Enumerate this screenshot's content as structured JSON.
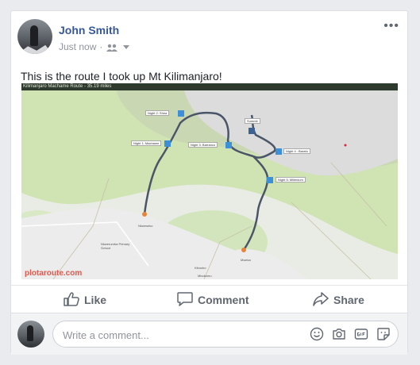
{
  "post": {
    "author": "John Smith",
    "time": "Just now",
    "more_label": "•••",
    "text": "This is the route I took up Mt Kilimanjaro!"
  },
  "map": {
    "title": "Kilimanjaro Machame Route - 35.19 miles",
    "logo": "plotaroute.com",
    "labels": {
      "night2": "Night 2: Shira",
      "night1": "Night 1: Machame",
      "night3": "Night 3: Barranco",
      "summit": "Summit",
      "night4": "Night 4 : Barafu",
      "night5": "Night 5: Millenium",
      "nkweseko": "Nkweseko",
      "mweka": "Mweka",
      "school": "Nkwerumba Primary School",
      "kibosho": "Kibosho",
      "mbokomu": "Mbokomu"
    }
  },
  "actions": {
    "like": "Like",
    "comment": "Comment",
    "share": "Share"
  },
  "comment_box": {
    "placeholder": "Write a comment..."
  },
  "icons": [
    "friends-icon",
    "dropdown-icon",
    "like-icon",
    "comment-icon",
    "share-icon",
    "emoji-icon",
    "camera-icon",
    "gif-icon",
    "sticker-icon"
  ],
  "colors": {
    "name": "#365899",
    "meta": "#90949c",
    "action": "#606770",
    "route": "#4a5668"
  }
}
